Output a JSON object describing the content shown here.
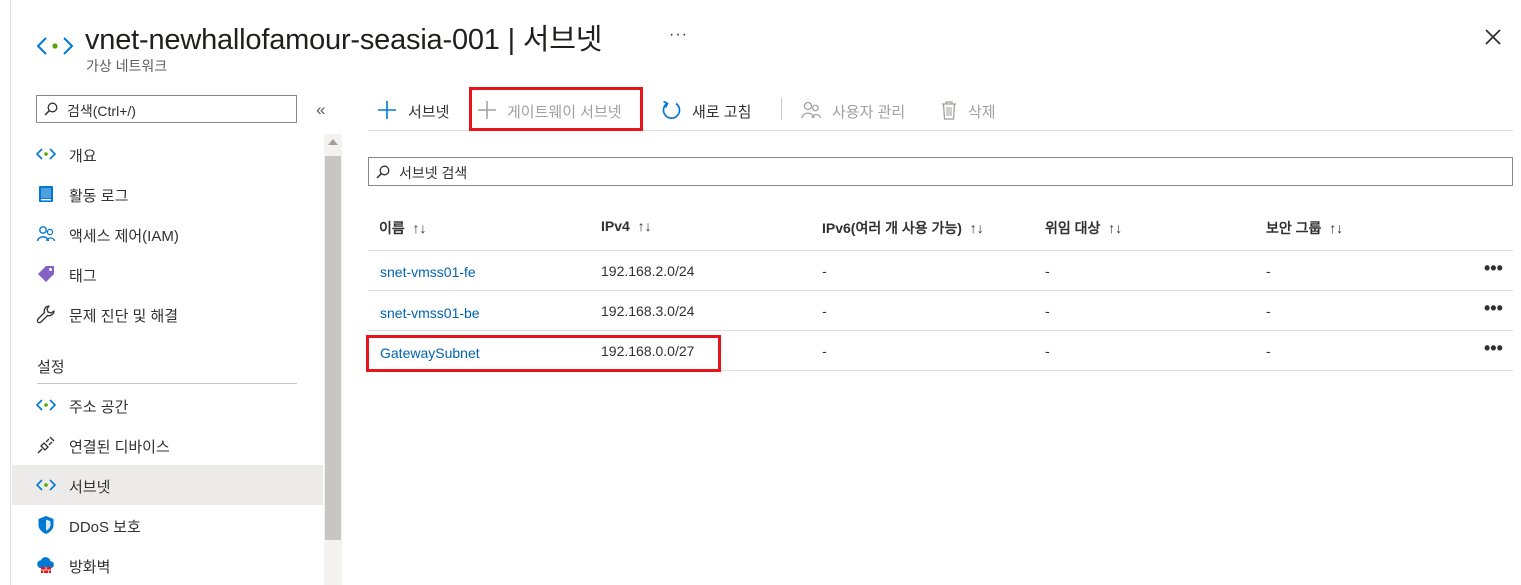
{
  "header": {
    "title": "vnet-newhallofamour-seasia-001 | 서브넷",
    "subtitle": "가상 네트워크",
    "more": "···"
  },
  "sidebar": {
    "search_placeholder": "검색(Ctrl+/)",
    "collapse": "«",
    "section_settings": "설정",
    "items": [
      {
        "label": "개요",
        "icon": "vnet-icon"
      },
      {
        "label": "활동 로그",
        "icon": "activity-log-icon"
      },
      {
        "label": "액세스 제어(IAM)",
        "icon": "iam-icon"
      },
      {
        "label": "태그",
        "icon": "tag-icon"
      },
      {
        "label": "문제 진단 및 해결",
        "icon": "wrench-icon"
      },
      {
        "label": "주소 공간",
        "icon": "vnet-icon"
      },
      {
        "label": "연결된 디바이스",
        "icon": "plug-icon"
      },
      {
        "label": "서브넷",
        "icon": "vnet-icon"
      },
      {
        "label": "DDoS 보호",
        "icon": "shield-icon"
      },
      {
        "label": "방화벽",
        "icon": "firewall-icon"
      }
    ]
  },
  "toolbar": {
    "add_subnet": "서브넷",
    "add_gateway_subnet": "게이트웨이 서브넷",
    "refresh": "새로 고침",
    "manage_users": "사용자 관리",
    "delete": "삭제"
  },
  "filter": {
    "placeholder": "서브넷 검색"
  },
  "table": {
    "sort_glyph": "↑↓",
    "columns": [
      "이름",
      "IPv4",
      "IPv6(여러 개 사용 가능)",
      "위임 대상",
      "보안 그룹"
    ],
    "rows": [
      {
        "name": "snet-vmss01-fe",
        "ipv4": "192.168.2.0/24",
        "ipv6": "-",
        "delegation": "-",
        "nsg": "-"
      },
      {
        "name": "snet-vmss01-be",
        "ipv4": "192.168.3.0/24",
        "ipv6": "-",
        "delegation": "-",
        "nsg": "-"
      },
      {
        "name": "GatewaySubnet",
        "ipv4": "192.168.0.0/27",
        "ipv6": "-",
        "delegation": "-",
        "nsg": "-"
      }
    ],
    "row_more": "•••"
  },
  "colors": {
    "link": "#0063b1",
    "highlight": "#e8141b",
    "selected_bg": "#edebe9",
    "accent": "#0078d4"
  }
}
